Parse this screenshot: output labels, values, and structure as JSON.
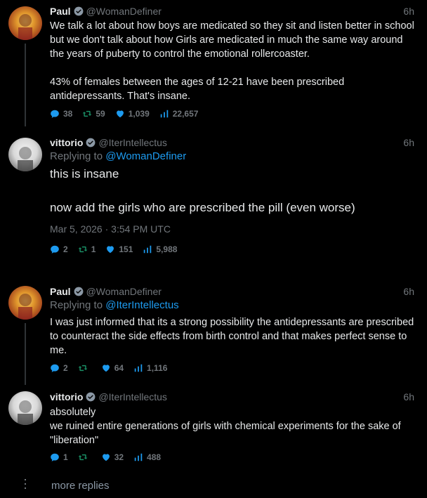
{
  "tweets": [
    {
      "name": "Paul",
      "handle": "@WomanDefiner",
      "time": "6h",
      "text": "We talk a lot about how boys are medicated so they sit and listen better in school but we don't talk about how Girls are medicated in much the same way around the years of puberty to control the emotional rollercoaster.\n\n43% of females between the ages of 12-21 have been prescribed antidepressants. That's insane.",
      "replies": "38",
      "retweets": "59",
      "likes": "1,039",
      "views": "22,657"
    },
    {
      "name": "vittorio",
      "handle": "@IterIntellectus",
      "time": "6h",
      "replying_label": "Replying to",
      "replying_to": "@WomanDefiner",
      "text": "this is insane\n\nnow add the girls who are prescribed the pill (even worse)",
      "date": "Mar 5, 2026 · 3:54 PM UTC",
      "replies": "2",
      "retweets": "1",
      "likes": "151",
      "views": "5,988"
    },
    {
      "name": "Paul",
      "handle": "@WomanDefiner",
      "time": "6h",
      "replying_label": "Replying to",
      "replying_to": "@IterIntellectus",
      "text": "I was just informed that its a strong possibility the antidepressants are prescribed to counteract the side effects from birth control and that makes perfect sense to me.",
      "replies": "2",
      "retweets": "",
      "likes": "64",
      "views": "1,116"
    },
    {
      "name": "vittorio",
      "handle": "@IterIntellectus",
      "time": "6h",
      "text": "absolutely\nwe ruined entire generations of girls with chemical experiments for the sake of \"liberation\"",
      "replies": "1",
      "retweets": "",
      "likes": "32",
      "views": "488"
    }
  ],
  "more_replies": "more replies",
  "icons": {
    "verified": "verified-badge-icon",
    "reply": "reply-icon",
    "retweet": "retweet-icon",
    "like": "heart-icon",
    "views": "views-icon"
  },
  "colors": {
    "background": "#000000",
    "accent": "#1d9bf0",
    "retweet": "#1a8f66",
    "muted": "#71767b"
  }
}
